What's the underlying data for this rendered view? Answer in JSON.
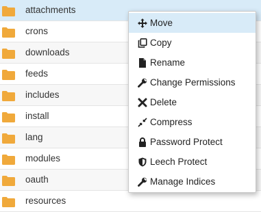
{
  "folders": [
    {
      "name": "attachments",
      "selected": true
    },
    {
      "name": "crons"
    },
    {
      "name": "downloads"
    },
    {
      "name": "feeds"
    },
    {
      "name": "includes"
    },
    {
      "name": "install"
    },
    {
      "name": "lang"
    },
    {
      "name": "modules"
    },
    {
      "name": "oauth"
    },
    {
      "name": "resources"
    }
  ],
  "context_menu": {
    "items": [
      {
        "label": "Move",
        "icon": "move-arrows-icon",
        "highlighted": true
      },
      {
        "label": "Copy",
        "icon": "copy-icon"
      },
      {
        "label": "Rename",
        "icon": "file-icon"
      },
      {
        "label": "Change Permissions",
        "icon": "wrench-icon"
      },
      {
        "label": "Delete",
        "icon": "x-icon"
      },
      {
        "label": "Compress",
        "icon": "compress-icon"
      },
      {
        "label": "Password Protect",
        "icon": "lock-icon"
      },
      {
        "label": "Leech Protect",
        "icon": "shield-icon"
      },
      {
        "label": "Manage Indices",
        "icon": "wrench-icon"
      }
    ]
  },
  "colors": {
    "folder": "#f0a93b",
    "selected_row": "#d8ebf8",
    "menu_highlight": "#d8ebf8"
  }
}
